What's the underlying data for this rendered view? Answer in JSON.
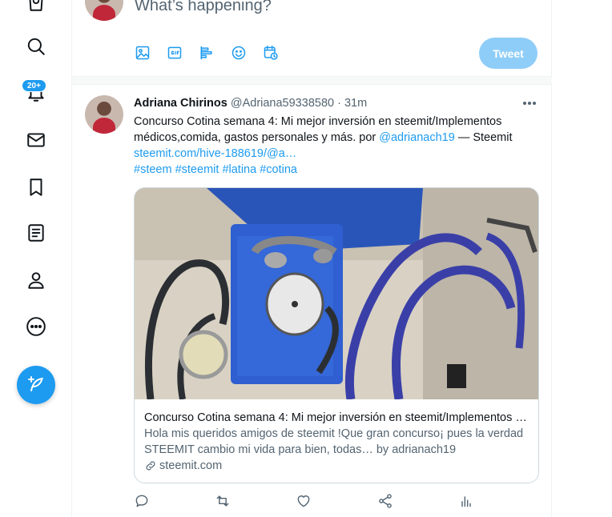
{
  "nav": {
    "items": [
      {
        "icon": "shopping-bag-icon"
      },
      {
        "icon": "search-icon"
      },
      {
        "icon": "bell-icon"
      },
      {
        "icon": "mail-icon"
      },
      {
        "icon": "bookmark-icon"
      },
      {
        "icon": "list-icon"
      },
      {
        "icon": "profile-icon"
      },
      {
        "icon": "more-circle-icon"
      }
    ],
    "notifications_badge": "20+",
    "compose_icon": "feather-plus-icon"
  },
  "compose": {
    "placeholder": "What’s happening?",
    "tools": [
      "image-icon",
      "gif-icon",
      "poll-icon",
      "emoji-icon",
      "schedule-icon"
    ],
    "tweet_label": "Tweet"
  },
  "tweet": {
    "name": "Adriana Chirinos",
    "handle": "@Adriana59338580",
    "separator": "·",
    "time": "31m",
    "text_line1": "Concurso Cotina semana 4: Mi mejor inversión en steemit/Implementos médicos,comida, gastos personales y más. por ",
    "mention": "@adrianach19",
    "text_suffix": " — Steemit",
    "url": "steemit.com/hive-188619/@a…",
    "hashtags": [
      "#steem",
      "#steemit",
      "#latina",
      "#cotina"
    ],
    "card": {
      "image": "blood-pressure-kit-photo",
      "title": "Concurso Cotina semana 4: Mi mejor inversión en steemit/Implementos médicos...",
      "description": "Hola mis queridos amigos de steemit !Que gran concurso¡ pues la verdad STEEMIT cambio mi vida para bien, todas… by adrianach19",
      "domain": "steemit.com"
    },
    "actions": [
      "reply-icon",
      "retweet-icon",
      "like-icon",
      "share-icon",
      "analytics-icon"
    ]
  },
  "colors": {
    "accent": "#1d9bf0",
    "tweet_button_disabled": "#8ecdf8",
    "secondary_text": "#536471"
  }
}
